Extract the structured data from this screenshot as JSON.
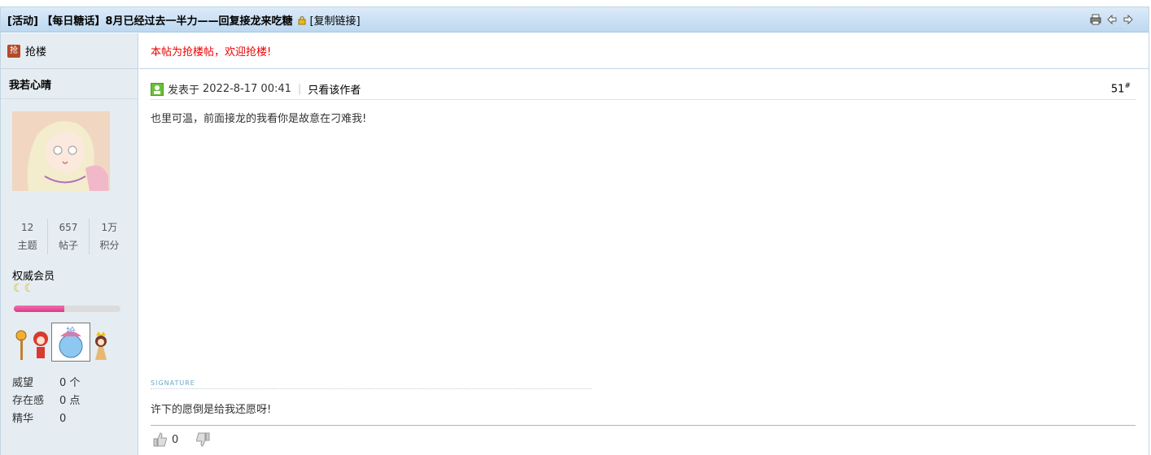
{
  "thread": {
    "title": "[活动] 【每日糖话】8月已经过去一半力——回复接龙来吃糖",
    "copy_link": "[复制链接]",
    "lock_icon": "lock-icon",
    "tools": [
      "print-icon",
      "prev-arrow-icon",
      "next-arrow-icon"
    ]
  },
  "sidebar": {
    "grab_label": "抢楼",
    "username": "我若心晴",
    "stats": [
      {
        "value": "12",
        "label": "主题"
      },
      {
        "value": "657",
        "label": "帖子"
      },
      {
        "value": "1万",
        "label": "积分"
      }
    ],
    "rank": "权威会员",
    "level_progress": 0.47,
    "info": [
      {
        "key": "威望",
        "value": "0 个"
      },
      {
        "key": "存在感",
        "value": "0 点"
      },
      {
        "key": "精华",
        "value": "0"
      }
    ]
  },
  "notice": "本帖为抢楼帖，欢迎抢楼!",
  "post": {
    "posted_prefix": "发表于",
    "posted_time": "2022-8-17 00:41",
    "only_author": "只看该作者",
    "floor": "51",
    "floor_mark": "#",
    "content": "也里可温，前面接龙的我看你是故意在刁难我!",
    "signature_label": "SIGNATURE",
    "signature": "许下的愿倒是给我还愿呀!",
    "like_count": "0"
  },
  "colors": {
    "notice": "#ee0000",
    "accent": "#bcd8f0",
    "sidebar": "#e5edf2",
    "progress": "#e0509a"
  }
}
